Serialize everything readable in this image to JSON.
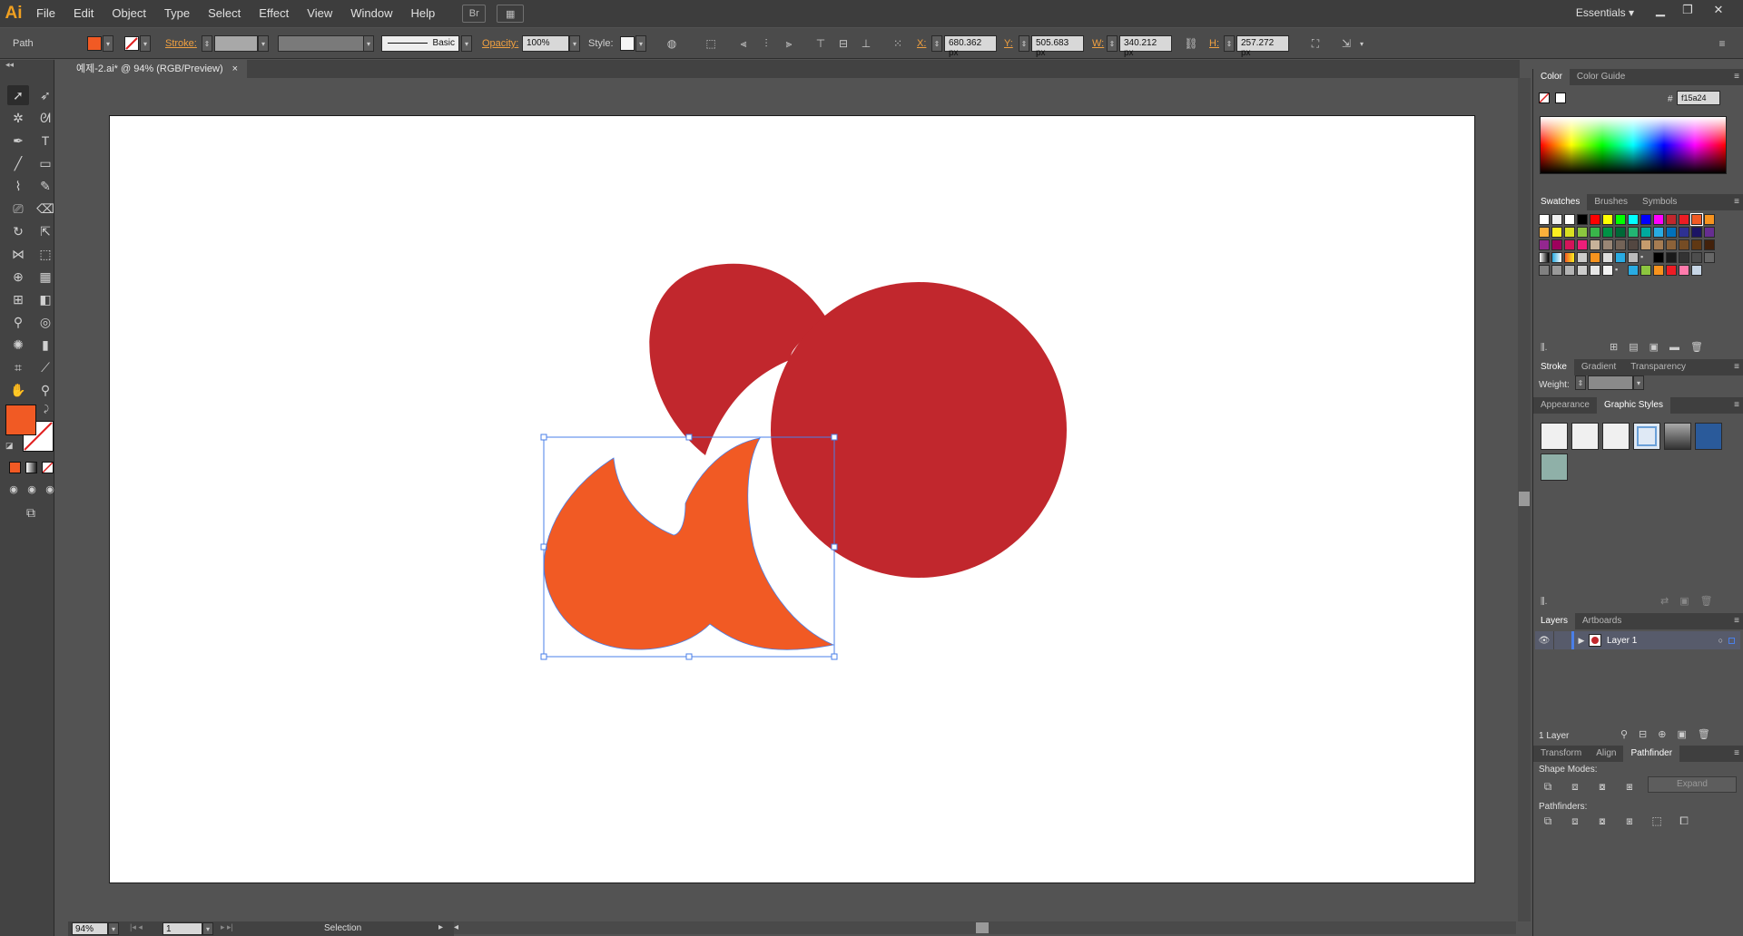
{
  "app": {
    "logo": "Ai",
    "workspace": "Essentials"
  },
  "menu": [
    "File",
    "Edit",
    "Object",
    "Type",
    "Select",
    "Effect",
    "View",
    "Window",
    "Help"
  ],
  "menu_icons": {
    "bridge": "Br",
    "arrange": "▦"
  },
  "control": {
    "object_type": "Path",
    "stroke_label": "Stroke:",
    "brush": "Basic",
    "opacity_label": "Opacity:",
    "opacity": "100%",
    "style_label": "Style:",
    "x_label": "X:",
    "x": "680.362 px",
    "y_label": "Y:",
    "y": "505.683 px",
    "w_label": "W:",
    "w": "340.212 px",
    "h_label": "H:",
    "h": "257.272 px"
  },
  "document": {
    "tab_title": "예제-2.ai* @ 94% (RGB/Preview)",
    "close": "×"
  },
  "status": {
    "zoom": "94%",
    "artboard": "1",
    "tool": "Selection"
  },
  "colors": {
    "fill": "#f15a24",
    "red": "#c1272d",
    "selection": "#4a7fe8"
  },
  "panels": {
    "color": {
      "tabs": [
        "Color",
        "Color Guide"
      ],
      "hash": "#",
      "hex": "f15a24"
    },
    "swatches": {
      "tabs": [
        "Swatches",
        "Brushes",
        "Symbols"
      ]
    },
    "stroke": {
      "tabs": [
        "Stroke",
        "Gradient",
        "Transparency"
      ],
      "weight_label": "Weight:"
    },
    "styles": {
      "tabs": [
        "Appearance",
        "Graphic Styles"
      ]
    },
    "layers": {
      "tabs": [
        "Layers",
        "Artboards"
      ],
      "layer_name": "Layer 1",
      "count": "1 Layer"
    },
    "pathfinder": {
      "tabs": [
        "Transform",
        "Align",
        "Pathfinder"
      ],
      "shape_modes": "Shape Modes:",
      "pathfinders": "Pathfinders:",
      "expand": "Expand"
    }
  }
}
